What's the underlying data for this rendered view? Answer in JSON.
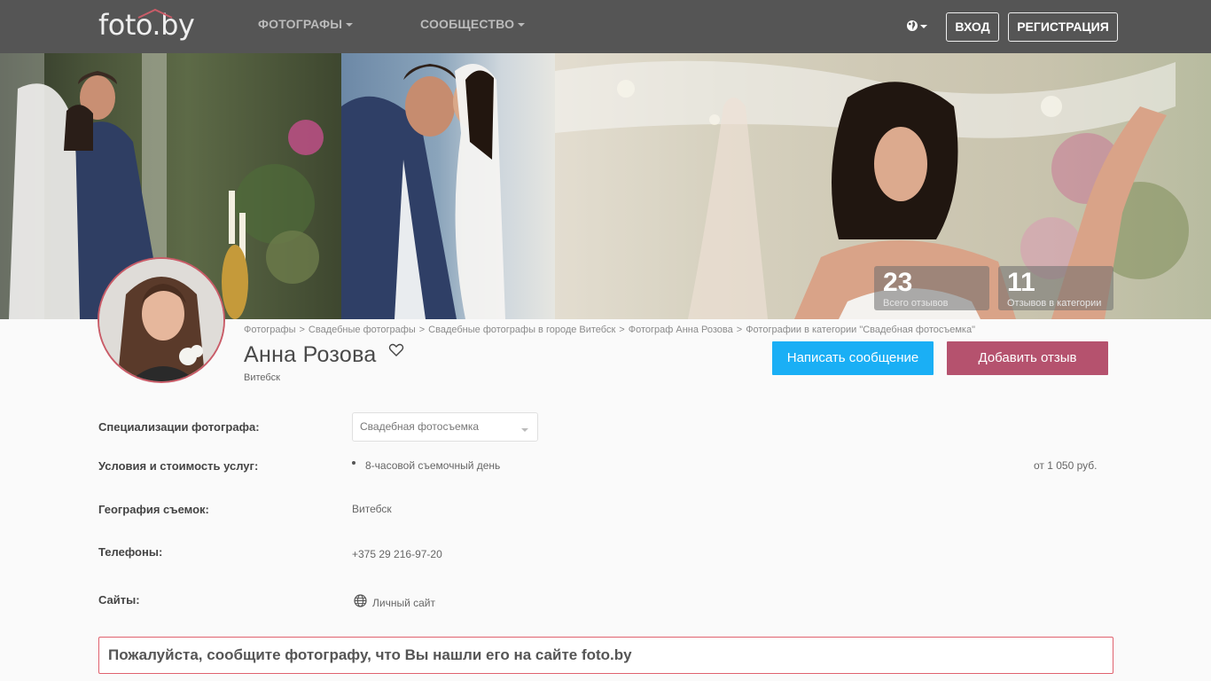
{
  "nav": {
    "logo": "foto.by",
    "links": [
      {
        "label": "ФОТОГРАФЫ"
      },
      {
        "label": "СООБЩЕСТВО"
      }
    ],
    "login": "ВХОД",
    "register": "РЕГИСТРАЦИЯ",
    "colors": {
      "bar": "#555555",
      "text": "#bbbbbb"
    }
  },
  "hero": {
    "stats": [
      {
        "value": "23",
        "label": "Всего отзывов"
      },
      {
        "value": "11",
        "label": "Отзывов в категории"
      }
    ]
  },
  "profile": {
    "breadcrumb": [
      "Фотографы",
      "Свадебные фотографы",
      "Свадебные фотографы в городе Витебск",
      "Фотограф Анна Розова",
      "Фотографии в категории \"Свадебная фотосъемка\""
    ],
    "breadcrumb_sep": ">",
    "name": "Анна Розова",
    "city": "Витебск",
    "buttons": {
      "message": "Написать сообщение",
      "review": "Добавить отзыв"
    }
  },
  "details": {
    "specializations_label": "Специализации фотографа:",
    "specialization_selected": "Свадебная фотосъемка",
    "services_label": "Условия и стоимость услуг:",
    "service_name": "8-часовой съемочный день",
    "service_price": "от 1 050 руб.",
    "geography_label": "География съемок:",
    "geography_value": "Витебск",
    "phones_label": "Телефоны:",
    "phone_value": "+375 29 216-97-20",
    "sites_label": "Сайты:",
    "site_value": "Личный сайт"
  },
  "notice": "Пожалуйста, сообщите фотографу, что Вы нашли его на сайте foto.by",
  "colors": {
    "accent_blue": "#1aaff5",
    "accent_rose": "#b5526e",
    "notice_border": "#e0626e"
  }
}
